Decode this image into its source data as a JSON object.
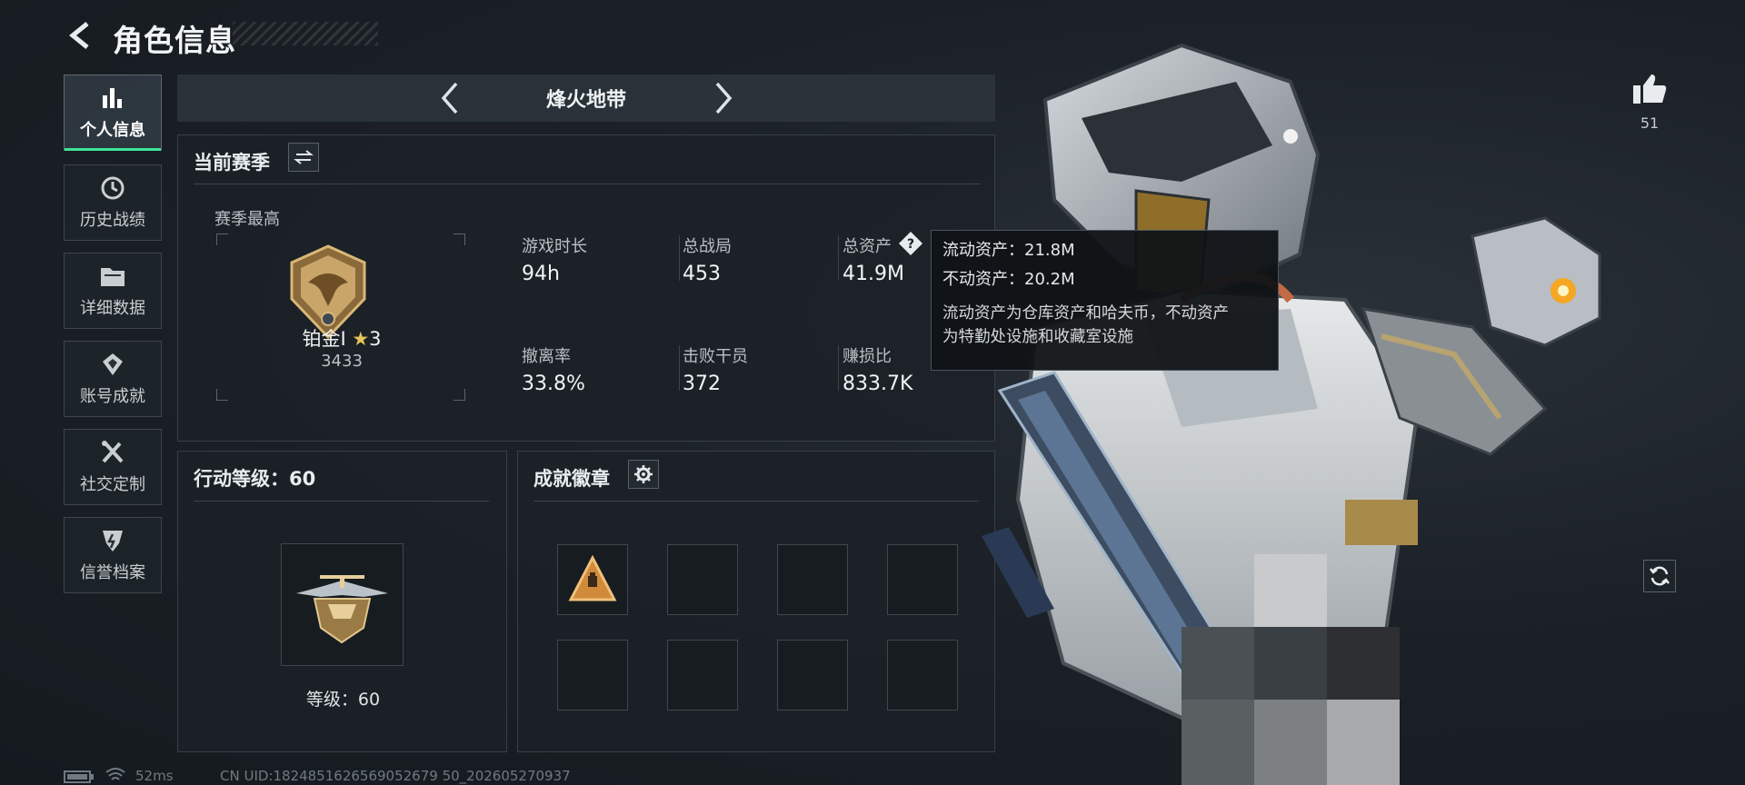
{
  "header": {
    "title": "角色信息"
  },
  "sidebar": {
    "items": [
      {
        "label": "个人信息",
        "active": true
      },
      {
        "label": "历史战绩"
      },
      {
        "label": "详细数据"
      },
      {
        "label": "账号成就"
      },
      {
        "label": "社交定制"
      },
      {
        "label": "信誉档案"
      }
    ]
  },
  "mode": {
    "name": "烽火地带"
  },
  "season": {
    "title": "当前赛季",
    "best_label": "赛季最高",
    "rank_name": "铂金Ⅰ",
    "rank_stars": "3",
    "rank_score": "3433",
    "stats": [
      {
        "label": "游戏时长",
        "value": "94h"
      },
      {
        "label": "总战局",
        "value": "453"
      },
      {
        "label": "总资产",
        "value": "41.9M"
      },
      {
        "label": "撤离率",
        "value": "33.8%"
      },
      {
        "label": "击败干员",
        "value": "372"
      },
      {
        "label": "赚损比",
        "value": "833.7K"
      }
    ]
  },
  "tooltip": {
    "line1": "流动资产：21.8M",
    "line2": "不动资产：20.2M",
    "desc1": "流动资产为仓库资产和哈夫币，不动资产",
    "desc2": "为特勤处设施和收藏室设施"
  },
  "level": {
    "title": "行动等级：60",
    "label": "等级：60"
  },
  "achievements": {
    "title": "成就徽章",
    "slots": 8
  },
  "likes": {
    "count": "51"
  },
  "status": {
    "ping": "52ms",
    "uid": "CN UID:1824851626569052679 50_202605270937"
  },
  "colors": {
    "accent": "#3fe39a",
    "tooltip_bg": "#101316",
    "panel_bg": "#1b2127"
  }
}
